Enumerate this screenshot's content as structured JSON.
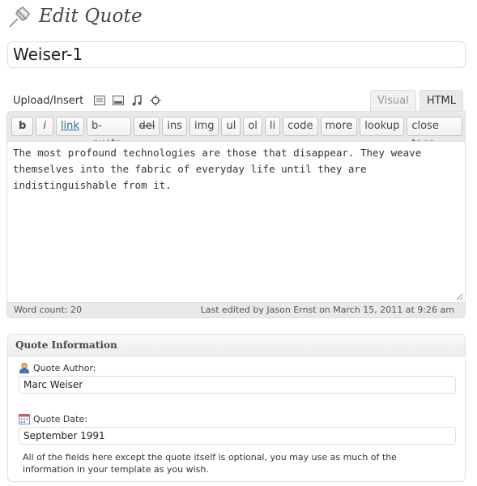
{
  "header": {
    "title": "Edit Quote",
    "icon": "pushpin-icon"
  },
  "post": {
    "title_value": "Weiser-1"
  },
  "media": {
    "label": "Upload/Insert",
    "icons": [
      "add-image-icon",
      "add-video-icon",
      "add-audio-icon",
      "add-media-icon"
    ]
  },
  "tabs": {
    "visual": "Visual",
    "html": "HTML",
    "active": "HTML"
  },
  "quicktags": [
    "b",
    "i",
    "link",
    "b-quote",
    "del",
    "ins",
    "img",
    "ul",
    "ol",
    "li",
    "code",
    "more",
    "lookup",
    "close tags"
  ],
  "content": {
    "text": "The most profound technologies are those that disappear. They weave themselves into the fabric of everyday life until they are indistinguishable from it."
  },
  "status": {
    "word_count": "Word count: 20",
    "last_edited": "Last edited by Jason Ernst on March 15, 2011 at 9:26 am"
  },
  "quote_info": {
    "heading": "Quote Information",
    "author_label": "Quote Author:",
    "author_value": "Marc Weiser",
    "date_label": "Quote Date:",
    "date_value": "September 1991",
    "help_text": "All of the fields here except the quote itself is optional, you may use as much of the information in your template as you wish."
  },
  "colors": {
    "link": "#21759b",
    "border": "#dfdfdf",
    "toolbar_bg": "#e9e9e9"
  }
}
